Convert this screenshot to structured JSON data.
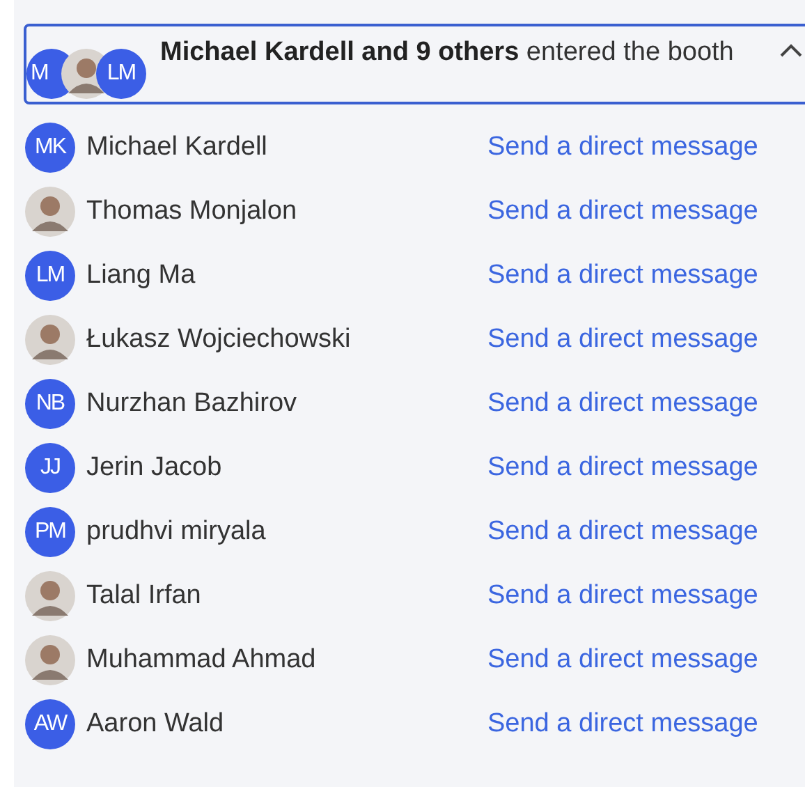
{
  "notification": {
    "avatars": [
      {
        "kind": "initials",
        "initials": "M"
      },
      {
        "kind": "photo"
      },
      {
        "kind": "initials",
        "initials": "LM"
      }
    ],
    "message": "**Michael Kardell and 9 others** entered the booth",
    "expanded": true
  },
  "people": [
    {
      "name": "Michael Kardell",
      "avatar": {
        "kind": "initials",
        "initials": "MK"
      },
      "action": "Send a direct message"
    },
    {
      "name": "Thomas Monjalon",
      "avatar": {
        "kind": "photo"
      },
      "action": "Send a direct message"
    },
    {
      "name": "Liang Ma",
      "avatar": {
        "kind": "initials",
        "initials": "LM"
      },
      "action": "Send a direct message"
    },
    {
      "name": "Łukasz Wojciechowski",
      "avatar": {
        "kind": "photo"
      },
      "action": "Send a direct message"
    },
    {
      "name": "Nurzhan Bazhirov",
      "avatar": {
        "kind": "initials",
        "initials": "NB"
      },
      "action": "Send a direct message"
    },
    {
      "name": "Jerin Jacob",
      "avatar": {
        "kind": "initials",
        "initials": "JJ"
      },
      "action": "Send a direct message"
    },
    {
      "name": "prudhvi miryala",
      "avatar": {
        "kind": "initials",
        "initials": "PM"
      },
      "action": "Send a direct message"
    },
    {
      "name": "Talal Irfan",
      "avatar": {
        "kind": "photo"
      },
      "action": "Send a direct message"
    },
    {
      "name": "Muhammad Ahmad",
      "avatar": {
        "kind": "photo"
      },
      "action": "Send a direct message"
    },
    {
      "name": "Aaron Wald",
      "avatar": {
        "kind": "initials",
        "initials": "AW"
      },
      "action": "Send a direct message"
    }
  ]
}
